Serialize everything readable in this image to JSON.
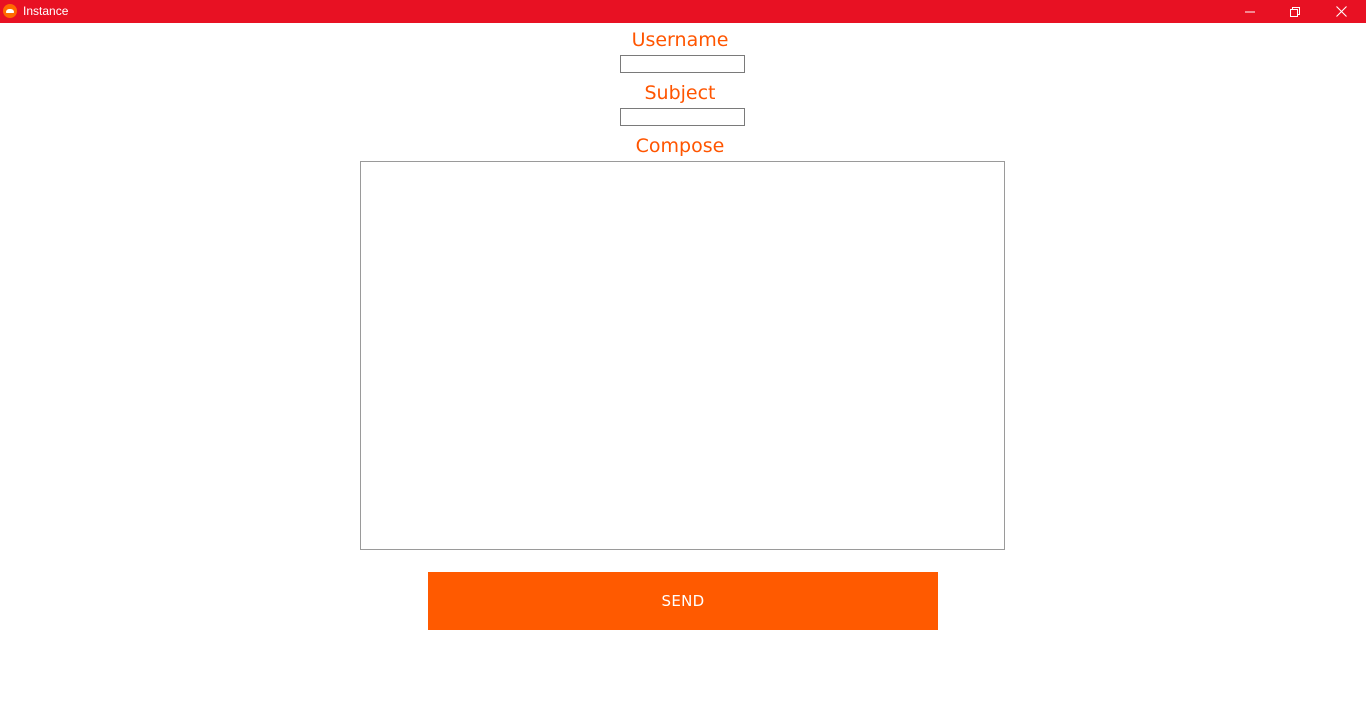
{
  "window": {
    "title": "Instance",
    "icon": "app-logo-icon",
    "controls": {
      "minimize_icon": "minimize-icon",
      "restore_icon": "restore-icon",
      "close_icon": "close-icon"
    },
    "titlebar_color": "#e81123"
  },
  "form": {
    "username_label": "Username",
    "username_value": "",
    "subject_label": "Subject",
    "subject_value": "",
    "compose_label": "Compose",
    "compose_value": "",
    "send_label": "SEND",
    "accent_color": "#ff5500"
  }
}
